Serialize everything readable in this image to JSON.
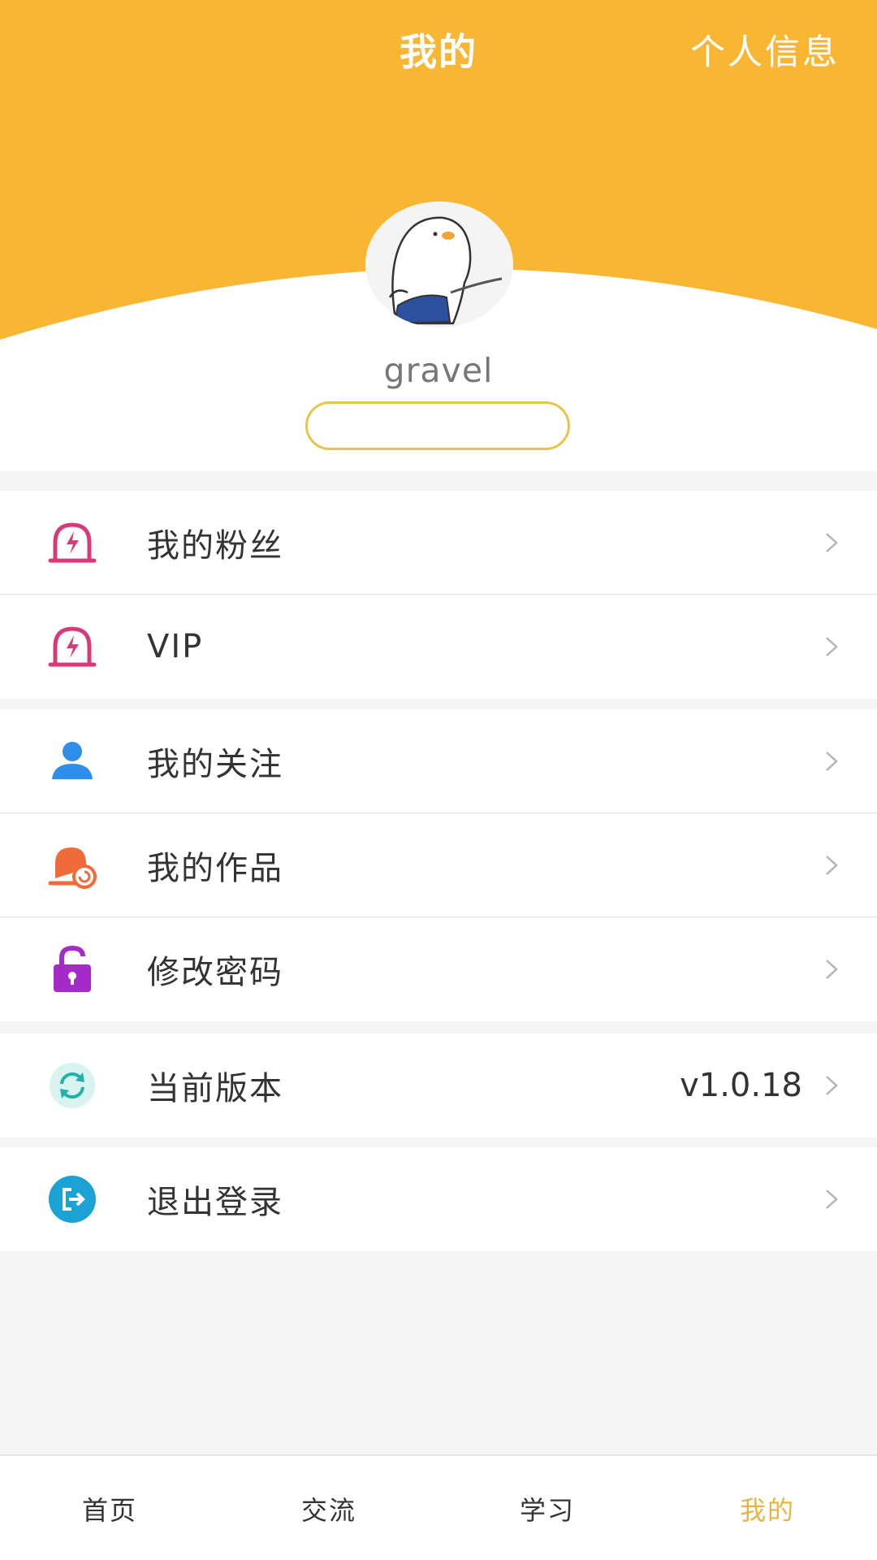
{
  "header": {
    "title": "我的",
    "action": "个人信息",
    "accent_color": "#f8b632"
  },
  "profile": {
    "username": "gravel",
    "avatar": "cartoon-bird-avatar",
    "badge_text": ""
  },
  "menu": {
    "fans": {
      "label": "我的粉丝",
      "icon": "bell-lightning-icon"
    },
    "vip": {
      "label": "VIP",
      "icon": "bell-lightning-icon"
    },
    "following": {
      "label": "我的关注",
      "icon": "user-icon"
    },
    "works": {
      "label": "我的作品",
      "icon": "works-icon"
    },
    "password": {
      "label": "修改密码",
      "icon": "padlock-icon"
    },
    "version": {
      "label": "当前版本",
      "value": "v1.0.18",
      "icon": "refresh-icon"
    },
    "logout": {
      "label": "退出登录",
      "icon": "logout-icon"
    }
  },
  "tabbar": {
    "home": "首页",
    "exchange": "交流",
    "study": "学习",
    "mine": "我的",
    "active": "mine",
    "active_color": "#e8b640"
  }
}
